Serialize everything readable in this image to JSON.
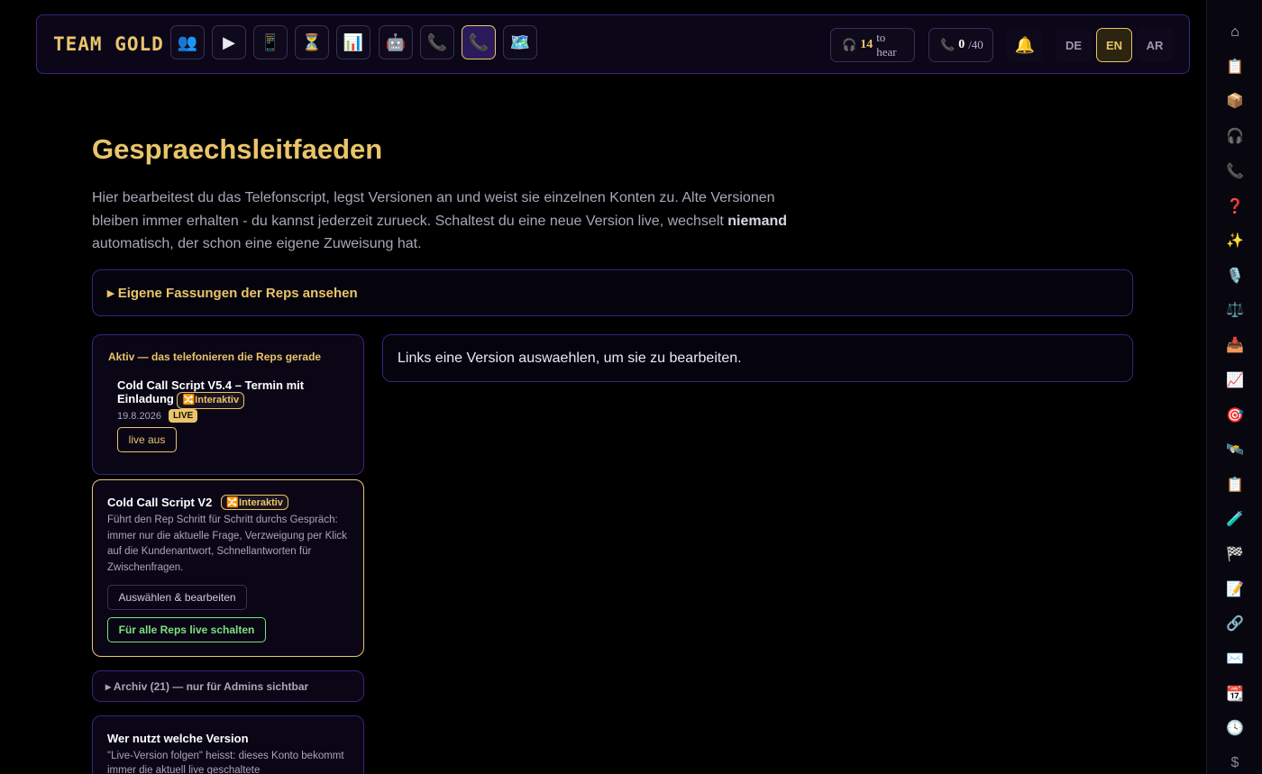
{
  "brand": "TEAM GOLD",
  "nav": [
    {
      "icon": "👥",
      "name": "team-icon"
    },
    {
      "icon": "▶",
      "name": "play-icon"
    },
    {
      "icon": "📱",
      "name": "mobile-phone-icon"
    },
    {
      "icon": "⏳",
      "name": "hourglass-icon"
    },
    {
      "icon": "📊",
      "name": "bar-chart-icon"
    },
    {
      "icon": "🤖",
      "name": "robot-icon"
    },
    {
      "icon": "📞",
      "name": "phone-receiver-icon"
    },
    {
      "icon": "📞",
      "name": "phone-receiver-active-icon"
    },
    {
      "icon": "🗺️",
      "name": "map-icon"
    }
  ],
  "status": {
    "hear_icon": "🎧",
    "hear_count": "14",
    "hear_label": "to hear",
    "calls_icon": "📞",
    "calls_count": "0",
    "calls_total": "/40",
    "bell_icon": "🔔"
  },
  "languages": [
    "DE",
    "EN",
    "AR"
  ],
  "active_language": "EN",
  "sidebar_icons": [
    {
      "icon": "⌂",
      "name": "home-icon"
    },
    {
      "icon": "📋",
      "name": "clipboard-icon"
    },
    {
      "icon": "📦",
      "name": "package-icon"
    },
    {
      "icon": "🎧",
      "name": "headphones-icon"
    },
    {
      "icon": "📞",
      "name": "phone-icon"
    },
    {
      "icon": "❓",
      "name": "question-icon"
    },
    {
      "icon": "✨",
      "name": "sparkles-icon"
    },
    {
      "icon": "🎙️",
      "name": "microphone-icon"
    },
    {
      "icon": "⚖️",
      "name": "scales-icon"
    },
    {
      "icon": "📥",
      "name": "inbox-icon"
    },
    {
      "icon": "📈",
      "name": "trend-chart-icon"
    },
    {
      "icon": "🎯",
      "name": "target-icon"
    },
    {
      "icon": "🛰️",
      "name": "satellite-icon"
    },
    {
      "icon": "📋",
      "name": "clipboard-2-icon"
    },
    {
      "icon": "🧪",
      "name": "test-tube-icon"
    },
    {
      "icon": "🏁",
      "name": "checkered-flag-icon"
    },
    {
      "icon": "📝",
      "name": "memo-icon"
    },
    {
      "icon": "🔗",
      "name": "link-icon"
    },
    {
      "icon": "✉️",
      "name": "envelope-icon"
    },
    {
      "icon": "📆",
      "name": "calendar-icon"
    },
    {
      "icon": "🕓",
      "name": "clock-icon"
    },
    {
      "icon": "$",
      "name": "dollar-icon"
    }
  ],
  "page": {
    "title": "Gespraechsleitfaeden",
    "intro_part1": "Hier bearbeitest du das Telefonscript, legst Versionen an und weist sie einzelnen Konten zu. Alte Versionen bleiben immer erhalten - du kannst jederzeit zurueck. Schaltest du eine neue Version live, wechselt ",
    "intro_bold": "niemand",
    "intro_part2": " automatisch, der schon eine eigene Zuweisung hat.",
    "reps_toggle": "▸ Eigene Fassungen der Reps ansehen",
    "edit_hint": "Links eine Version auswaehlen, um sie zu bearbeiten."
  },
  "active_card": {
    "heading": "Aktiv — das telefonieren die Reps gerade",
    "script_title": "Cold Call Script V5.4 – Termin mit Einladung",
    "interactive_badge": "🔀Interaktiv",
    "date": "19.8.2026",
    "live_badge": "LIVE",
    "live_off_button": "live aus"
  },
  "v2_card": {
    "title": "Cold Call Script V2",
    "interactive_badge": "🔀Interaktiv",
    "description": "Führt den Rep Schritt für Schritt durchs Gespräch: immer nur die aktuelle Frage, Verzweigung per Klick auf die Kundenantwort, Schnellantworten für Zwischenfragen.",
    "select_button": "Auswählen & bearbeiten",
    "go_live_button": "Für alle Reps live schalten"
  },
  "archive": {
    "label": "▸ Archiv (21) — nur für Admins sichtbar"
  },
  "who_card": {
    "title": "Wer nutzt welche Version",
    "text": "\"Live-Version folgen\" heisst: dieses Konto bekommt immer die aktuell live geschaltete"
  },
  "colors": {
    "accent_gold": "#e9c46a",
    "border_purple": "#3b2380",
    "green": "#7ee07e"
  }
}
